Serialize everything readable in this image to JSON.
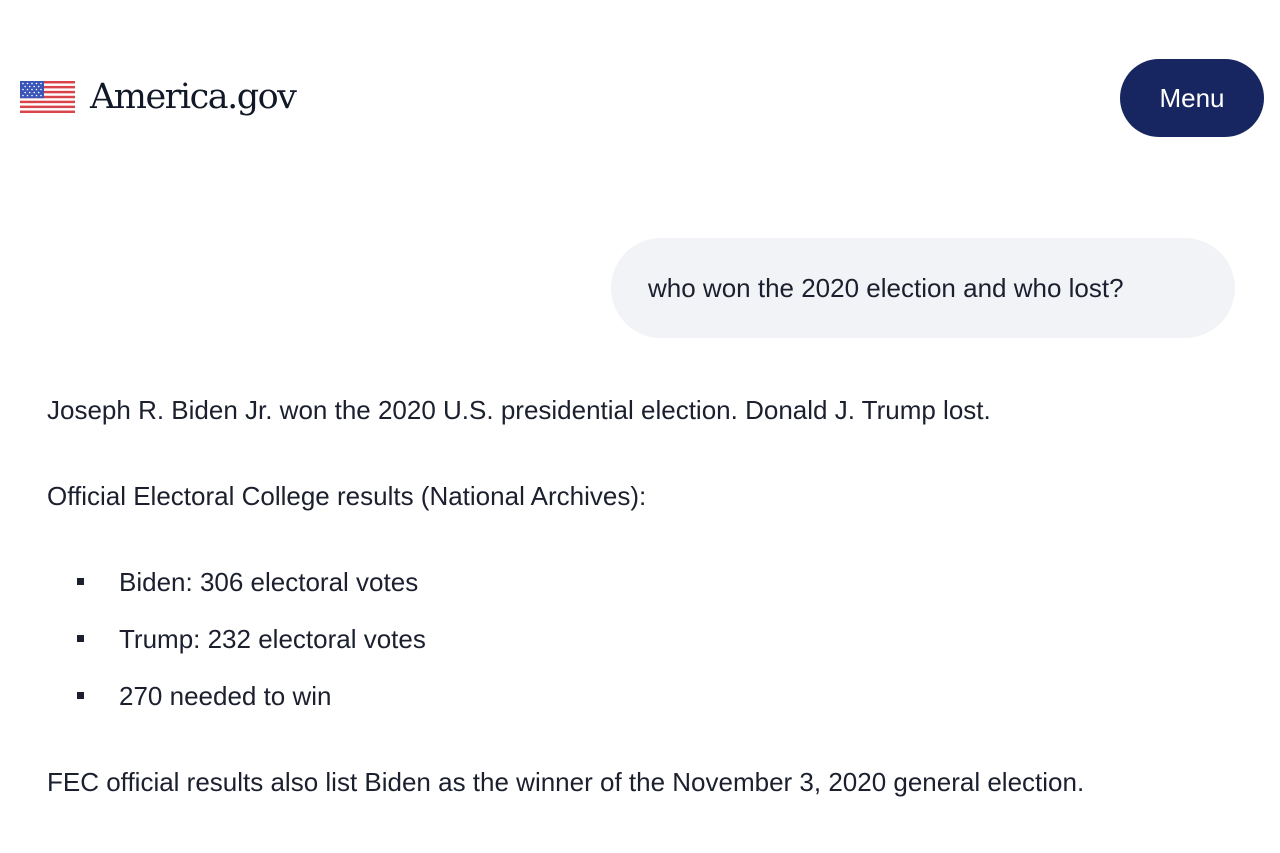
{
  "header": {
    "brand_name": "America.gov",
    "flag_icon": "us-flag-icon",
    "menu_label": "Menu"
  },
  "colors": {
    "menu_button_bg": "#172660",
    "user_bubble_bg": "#f2f3f6",
    "text": "#1b1f2e",
    "flag_red": "#d9434a",
    "flag_blue": "#3a56b8"
  },
  "conversation": {
    "user_message": "who won the 2020 election and who lost?",
    "response": {
      "paragraph_1": "Joseph R. Biden Jr. won the 2020 U.S. presidential election. Donald J. Trump lost.",
      "paragraph_2": "Official Electoral College results (National Archives):",
      "bullets": [
        "Biden: 306 electoral votes",
        "Trump: 232 electoral votes",
        "270 needed to win"
      ],
      "paragraph_3": "FEC official results also list Biden as the winner of the November 3, 2020 general election."
    }
  }
}
